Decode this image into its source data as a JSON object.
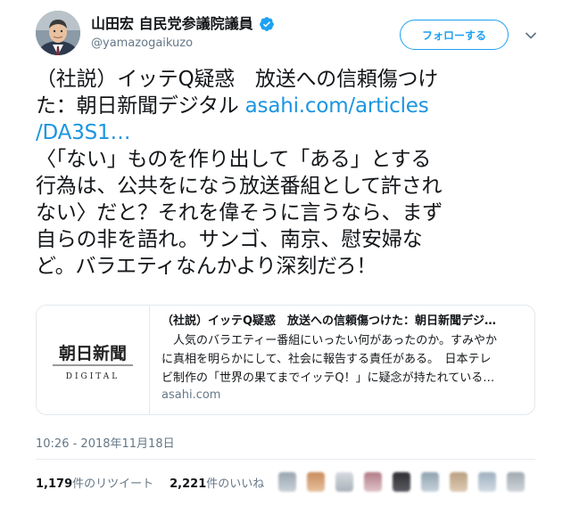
{
  "user": {
    "display_name": "山田宏 自民党参議院議員",
    "handle": "@yamazogaikuzo",
    "avatar_icon": "avatar",
    "verified_icon": "verified-icon",
    "verified_color": "#1da1f2"
  },
  "header": {
    "follow_label": "フォローする",
    "menu_icon": "chevron-down-icon"
  },
  "tweet": {
    "line1": "（社説）イッテQ疑惑　放送への信頼傷つけ",
    "line2_text": "た：朝日新聞デジタル ",
    "line2_link": "asahi.com/articles",
    "line3_link": "/DA3S1…",
    "line4": "〈「ない」ものを作り出して「ある」とする",
    "line5": "行為は、公共をになう放送番組として許され",
    "line6": "ない〉だと？それを偉そうに言うなら、まず",
    "line7": "自らの非を語れ。サンゴ、南京、慰安婦な",
    "line8": "ど。バラエティなんかより深刻だろ！",
    "link_color": "#1b95e0"
  },
  "card": {
    "thumbnail_logo_text": "朝日新聞",
    "thumbnail_sub_text": "DIGITAL",
    "title": "（社説）イッテQ疑惑　放送への信頼傷つけた：朝日新聞デジ…",
    "desc_line1": "　人気のバラエティー番組にいったい何があったのか。すみやか",
    "desc_line2": "に真相を明らかにして、社会に報告する責任がある。　日本テレ",
    "desc_line3": "ビ制作の「世界の果てまでイッテQ！」に疑念が持たれている…",
    "domain": "asahi.com"
  },
  "meta": {
    "timestamp": "10:26 - 2018年11月18日"
  },
  "stats": {
    "retweet_count": "1,179",
    "retweet_label": "件のリツイート",
    "like_count": "2,221",
    "like_label": "件のいいね"
  },
  "colors": {
    "accent": "#1da1f2",
    "text": "#14171a",
    "muted": "#657786",
    "border": "#e1e8ed"
  }
}
